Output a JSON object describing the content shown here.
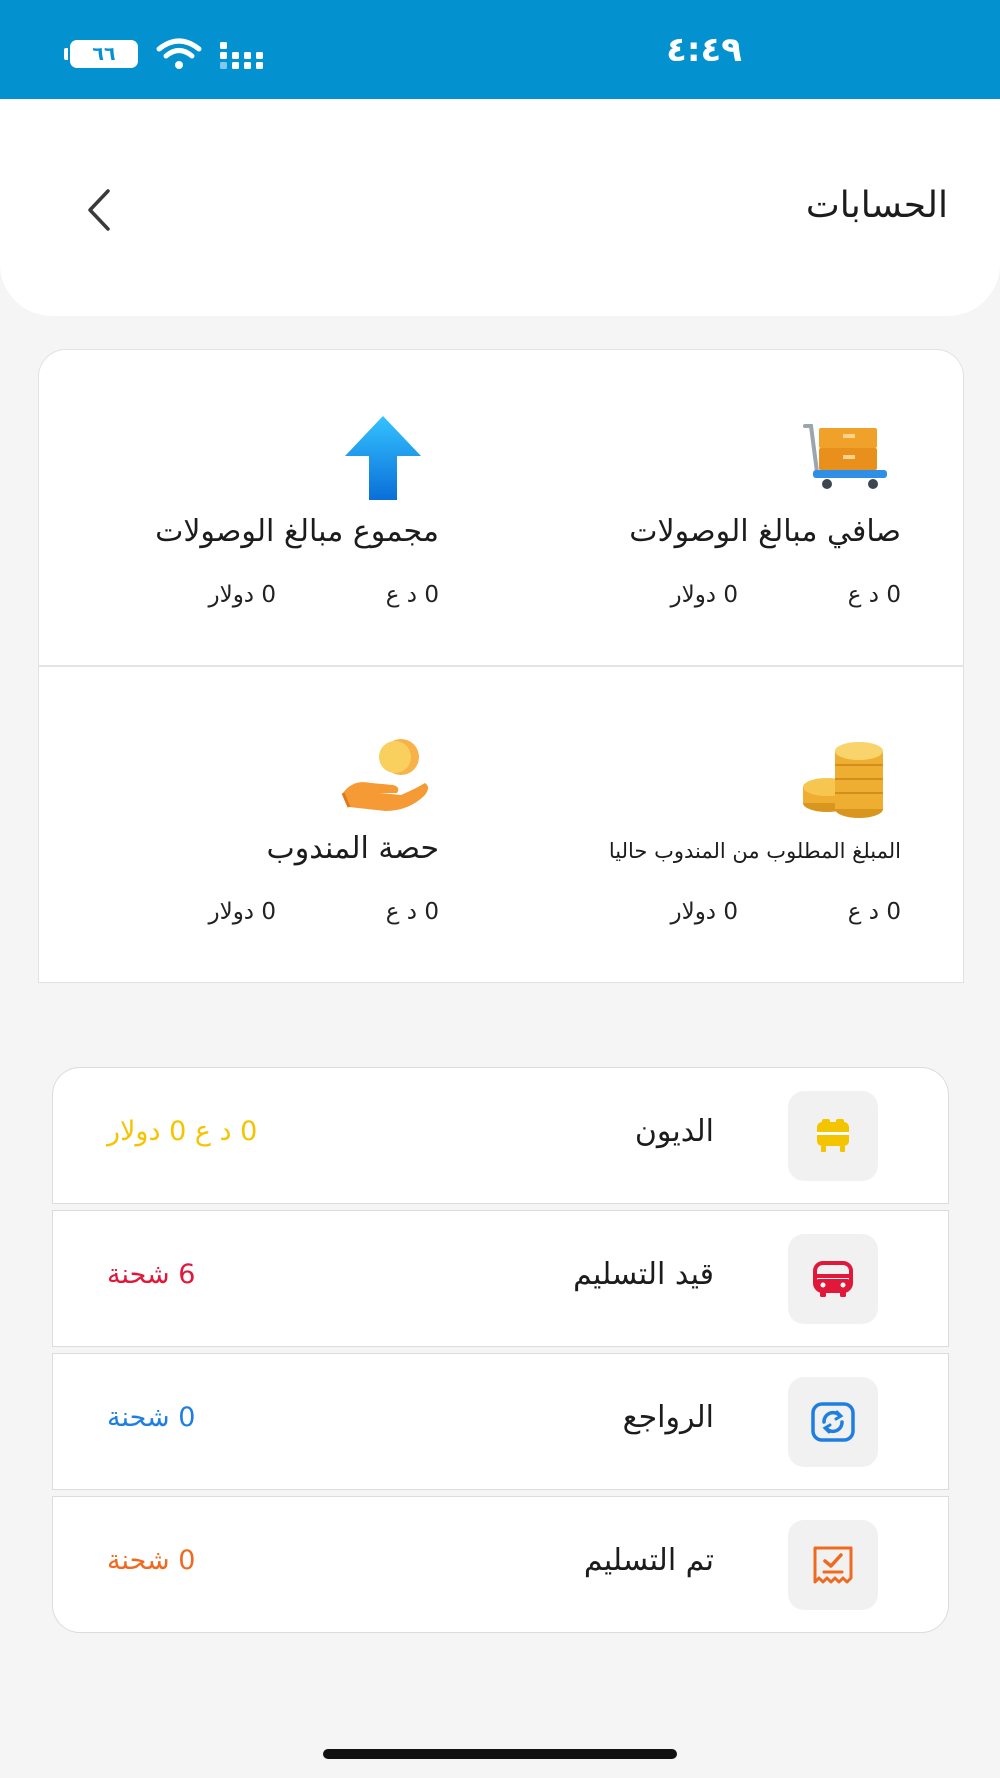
{
  "status_bar": {
    "time": "٤:٤٩",
    "battery": "٦٦"
  },
  "header": {
    "title": "الحسابات"
  },
  "summary": {
    "net_receipts": {
      "label": "صافي مبالغ الوصولات",
      "amount_iqd": "0 د ع",
      "amount_usd": "0 دولار",
      "icon": "cart-boxes-icon"
    },
    "total_receipts": {
      "label": "مجموع مبالغ الوصولات",
      "amount_iqd": "0 د ع",
      "amount_usd": "0 دولار",
      "icon": "arrow-up-icon"
    },
    "required_from_delegate": {
      "label": "المبلغ المطلوب من المندوب حاليا",
      "amount_iqd": "0 د ع",
      "amount_usd": "0 دولار",
      "icon": "coins-stack-icon"
    },
    "delegate_share": {
      "label": "حصة المندوب",
      "amount_iqd": "0 د ع",
      "amount_usd": "0 دولار",
      "icon": "hand-coin-icon"
    }
  },
  "list": [
    {
      "label": "الديون",
      "value": "0 د ع  0 دولار",
      "color": "#f5c400",
      "icon": "debt-icon"
    },
    {
      "label": "قيد التسليم",
      "value": "6 شحنة",
      "color": "#e0193a",
      "icon": "bus-icon"
    },
    {
      "label": "الرواجع",
      "value": "0 شحنة",
      "color": "#1f7fe0",
      "icon": "return-icon"
    },
    {
      "label": "تم التسليم",
      "value": "0 شحنة",
      "color": "#ee6a21",
      "icon": "receipt-check-icon"
    }
  ]
}
